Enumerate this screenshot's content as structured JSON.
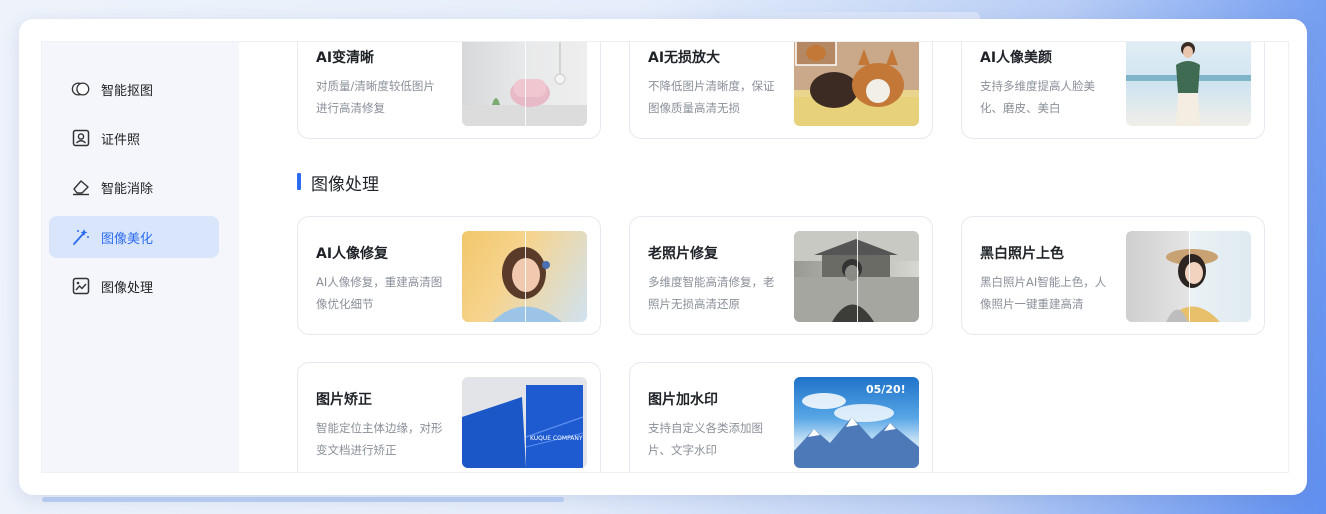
{
  "sidebar": {
    "items": [
      {
        "label": "智能抠图",
        "icon": "cutout-icon"
      },
      {
        "label": "证件照",
        "icon": "id-photo-icon"
      },
      {
        "label": "智能消除",
        "icon": "eraser-icon"
      },
      {
        "label": "图像美化",
        "icon": "magic-wand-icon",
        "active": true
      },
      {
        "label": "图像处理",
        "icon": "image-edit-icon"
      }
    ]
  },
  "top_cards": [
    {
      "title": "AI变清晰",
      "desc": "对质量/清晰度较低图片进行高清修复"
    },
    {
      "title": "AI无损放大",
      "desc": "不降低图片清晰度，保证图像质量高清无损"
    },
    {
      "title": "AI人像美颜",
      "desc": "支持多维度提高人脸美化、磨皮、美白"
    }
  ],
  "section": {
    "title": "图像处理"
  },
  "cards": [
    {
      "title": "AI人像修复",
      "desc": "AI人像修复，重建高清图像优化细节"
    },
    {
      "title": "老照片修复",
      "desc": "多维度智能高清修复，老照片无损高清还原"
    },
    {
      "title": "黑白照片上色",
      "desc": "黑白照片AI智能上色，人像照片一键重建高清"
    },
    {
      "title": "图片矫正",
      "desc": "智能定位主体边缘，对形变文档进行矫正"
    },
    {
      "title": "图片加水印",
      "desc": "支持自定义各类添加图片、文字水印"
    }
  ],
  "thumb_text": {
    "company": "KUQUE COMPANY",
    "watermark": "05/20!"
  },
  "colors": {
    "accent": "#2c6cf1",
    "active_bg": "#d9e5fb"
  }
}
